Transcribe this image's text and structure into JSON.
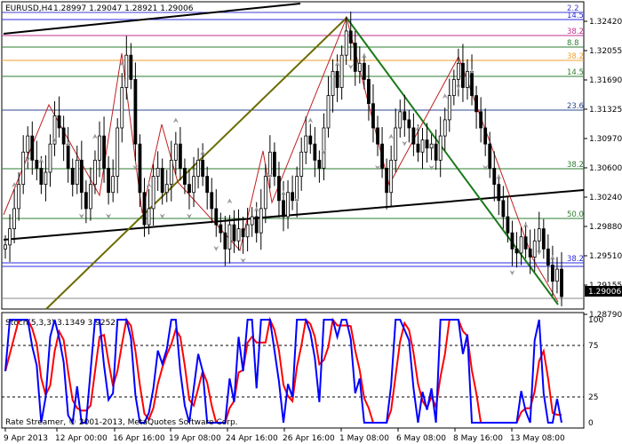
{
  "window": {
    "symbol_header": "EURUSD,H4",
    "ohlc": "1.28997 1.29047 1.28921 1.29006"
  },
  "price_axis": {
    "labels": [
      "1.32420",
      "1.32055",
      "1.31690",
      "1.31325",
      "1.30970",
      "1.30600",
      "1.30240",
      "1.29880",
      "1.29510",
      "1.29155",
      "1.28790"
    ],
    "current_price": "1.29006"
  },
  "time_axis": {
    "labels": [
      "9 Apr 2013",
      "12 Apr 00:00",
      "16 Apr 16:00",
      "19 Apr 08:00",
      "24 Apr 16:00",
      "26 Apr 16:00",
      "1 May 08:00",
      "6 May 08:00",
      "8 May 16:00",
      "13 May 08:00"
    ]
  },
  "fib_levels": [
    {
      "label": "2.2",
      "color": "#3b3bd1"
    },
    {
      "label": "14.5",
      "color": "#2b2be0"
    },
    {
      "label": "38.2",
      "color": "#c0308f"
    },
    {
      "label": "8.8",
      "color": "#2e7d32"
    },
    {
      "label": "38.2",
      "color": "#f0a030"
    },
    {
      "label": "14.5",
      "color": "#2e7d32"
    },
    {
      "label": "23.6",
      "color": "#2b4a8c"
    },
    {
      "label": "38.2",
      "color": "#2e7d32"
    },
    {
      "label": "50.0",
      "color": "#2e7d32"
    },
    {
      "label": "38.2",
      "color": "#2b2be0"
    }
  ],
  "stochastic": {
    "label": "Stoch(5,3,3) 3.1349 3.9252",
    "levels": [
      "100",
      "75",
      "25",
      "0"
    ],
    "main_color": "#0000ff",
    "signal_color": "#ff0000"
  },
  "footer": {
    "copyright": "Rate Streamer, © 2001-2013, MetaQuotes Software Corp."
  },
  "chart_data": {
    "type": "candlestick",
    "symbol": "EURUSD",
    "timeframe": "H4",
    "ylim": [
      1.2879,
      1.3242
    ],
    "close": [
      1.2965,
      1.2985,
      1.301,
      1.304,
      1.308,
      1.31,
      1.307,
      1.306,
      1.304,
      1.3055,
      1.309,
      1.3125,
      1.311,
      1.309,
      1.306,
      1.304,
      1.307,
      1.303,
      1.301,
      1.304,
      1.307,
      1.31,
      1.306,
      1.303,
      1.305,
      1.311,
      1.316,
      1.32,
      1.317,
      1.309,
      1.303,
      1.299,
      1.301,
      1.305,
      1.306,
      1.303,
      1.304,
      1.307,
      1.309,
      1.306,
      1.304,
      1.303,
      1.305,
      1.307,
      1.305,
      1.303,
      1.301,
      1.299,
      1.298,
      1.296,
      1.299,
      1.297,
      1.2985,
      1.2975,
      1.299,
      1.3,
      1.298,
      1.301,
      1.305,
      1.308,
      1.305,
      1.302,
      1.3,
      1.303,
      1.302,
      1.305,
      1.308,
      1.31,
      1.309,
      1.307,
      1.306,
      1.311,
      1.315,
      1.318,
      1.316,
      1.32,
      1.323,
      1.3215,
      1.318,
      1.319,
      1.317,
      1.314,
      1.311,
      1.309,
      1.306,
      1.303,
      1.307,
      1.311,
      1.313,
      1.312,
      1.311,
      1.309,
      1.308,
      1.3095,
      1.3085,
      1.309,
      1.307,
      1.31,
      1.312,
      1.315,
      1.317,
      1.319,
      1.316,
      1.318,
      1.315,
      1.313,
      1.311,
      1.309,
      1.306,
      1.304,
      1.302,
      1.3,
      1.298,
      1.296,
      1.2955,
      1.2975,
      1.296,
      1.295,
      1.297,
      1.2985,
      1.296,
      1.294,
      1.292,
      1.2935,
      1.2901
    ]
  }
}
